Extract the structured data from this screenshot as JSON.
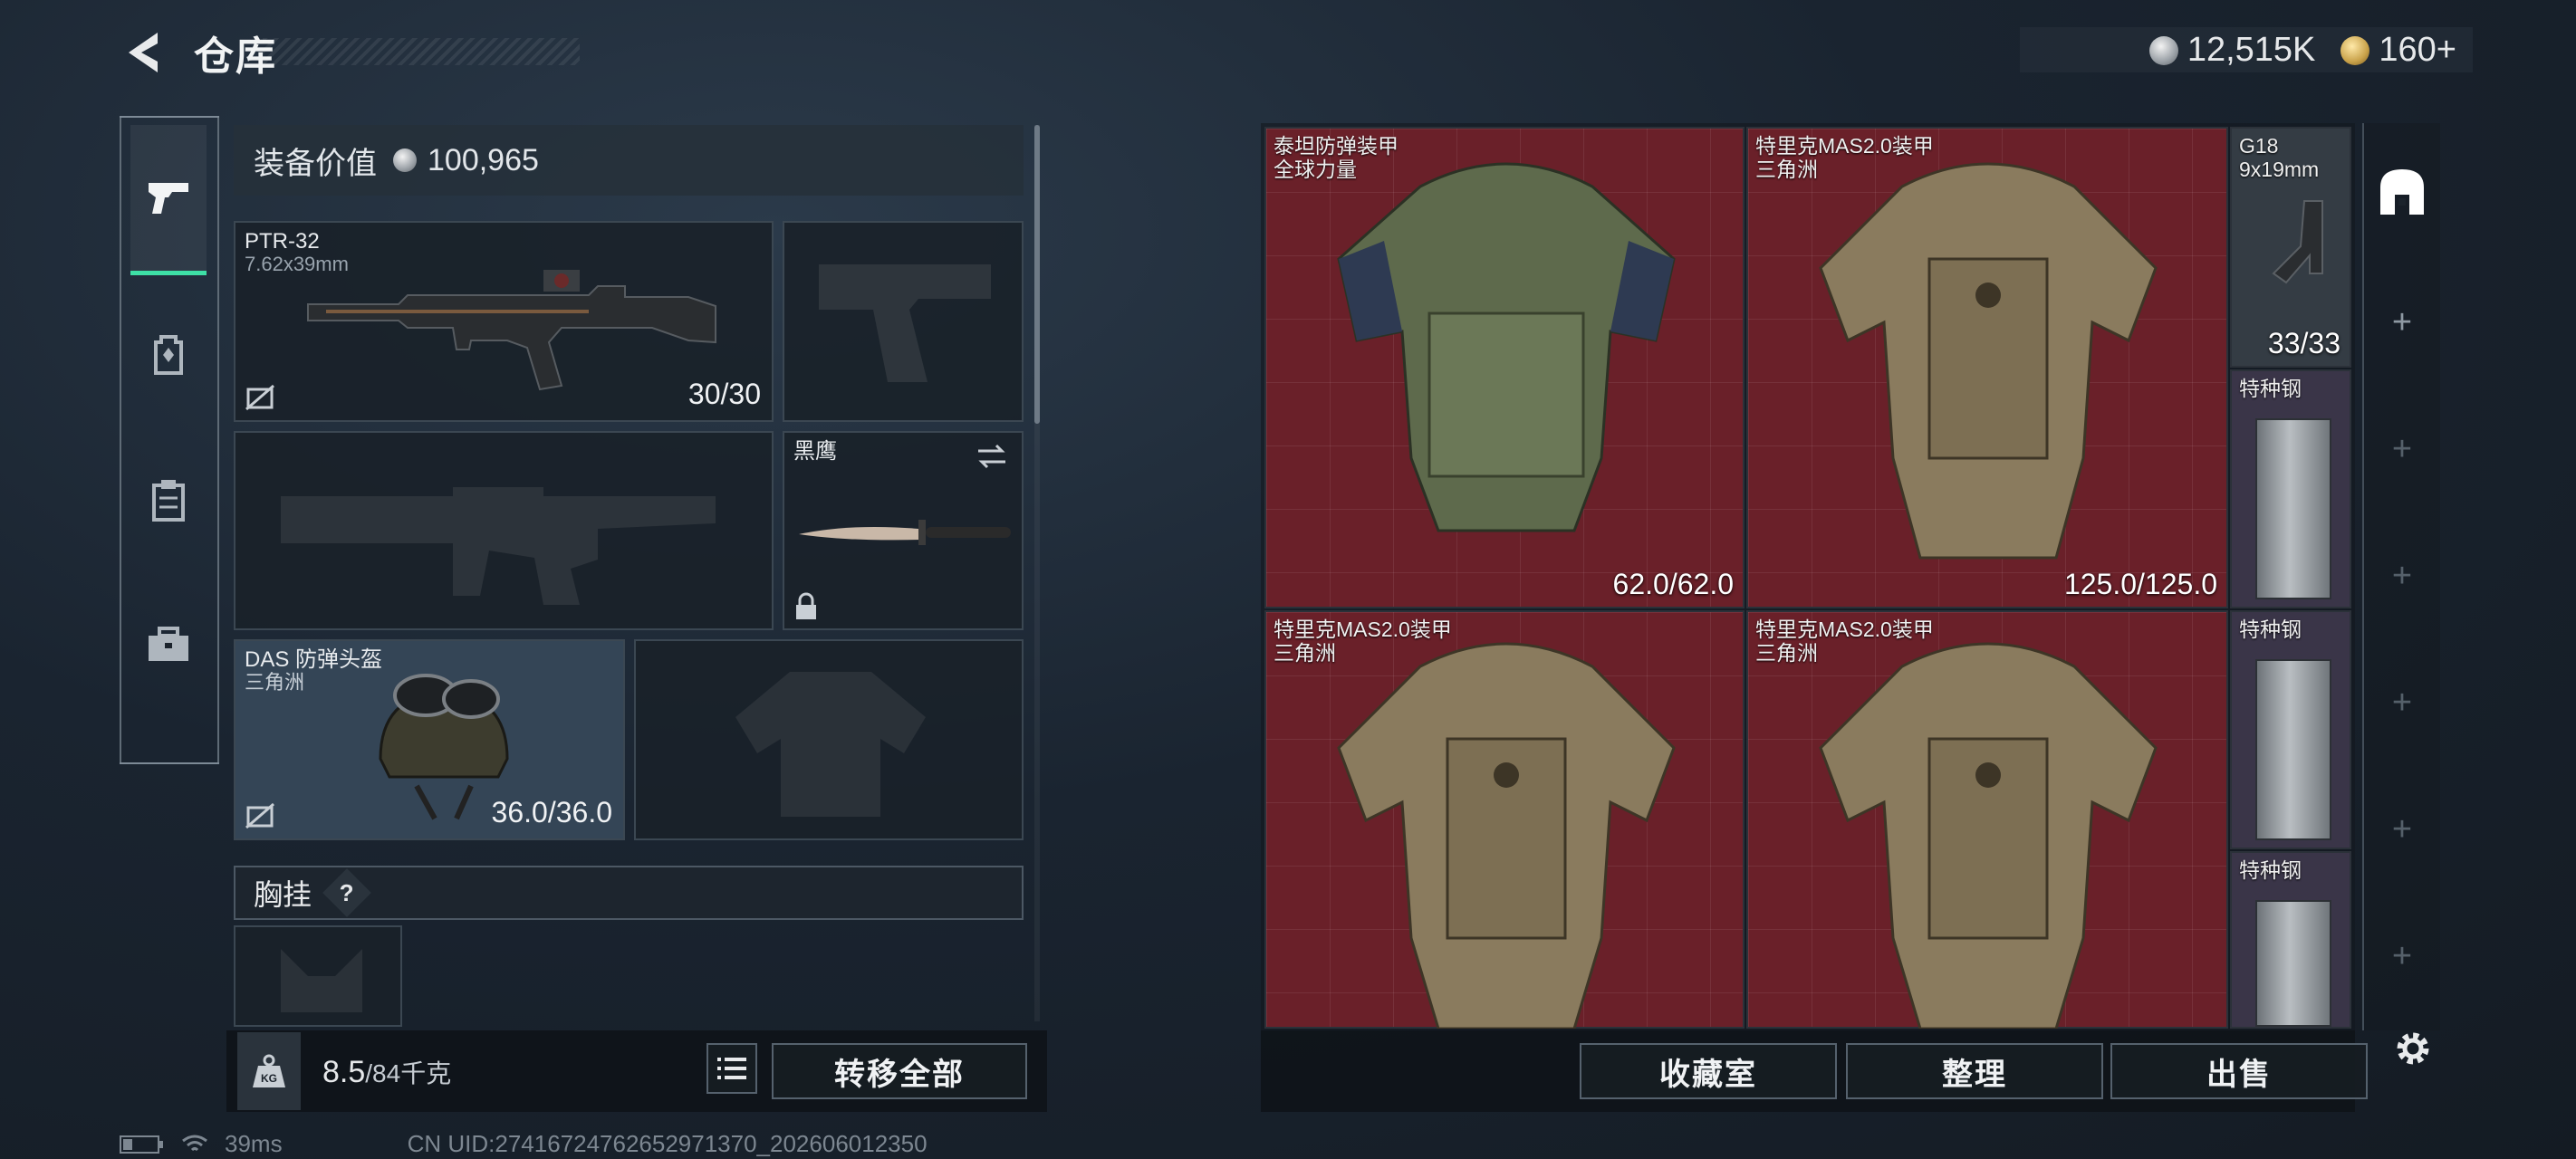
{
  "header": {
    "title": "仓库"
  },
  "currency": {
    "silver": "12,515K",
    "gold": "160+"
  },
  "rail": [
    {
      "name": "weapon",
      "icon": "pistol-icon",
      "active": true
    },
    {
      "name": "gear",
      "icon": "backpack-icon",
      "active": false
    },
    {
      "name": "clipboard",
      "icon": "clipboard-icon",
      "active": false
    },
    {
      "name": "toolbox",
      "icon": "toolbox-icon",
      "active": false
    }
  ],
  "equipment": {
    "value_label": "装备价值",
    "value": "100,965",
    "primary": {
      "name": "PTR-32",
      "caliber": "7.62x39mm",
      "ammo": "30/30"
    },
    "melee": {
      "name": "黑鹰"
    },
    "helmet": {
      "name": "DAS 防弹头盔",
      "brand": "三角洲",
      "durability": "36.0/36.0"
    },
    "chest_label": "胸挂",
    "help": "?",
    "weight": {
      "current": "8.5",
      "max": "/84千克"
    },
    "transfer_all": "转移全部"
  },
  "storage": {
    "items": [
      {
        "name": "泰坦防弹装甲",
        "brand": "全球力量",
        "durability": "62.0/62.0"
      },
      {
        "name": "特里克MAS2.0装甲",
        "brand": "三角洲",
        "durability": "125.0/125.0"
      },
      {
        "name": "G18",
        "brand": "9x19mm",
        "durability": "33/33"
      },
      {
        "name": "特种钢",
        "brand": "",
        "durability": ""
      },
      {
        "name": "特里克MAS2.0装甲",
        "brand": "三角洲",
        "durability": ""
      },
      {
        "name": "特里克MAS2.0装甲",
        "brand": "三角洲",
        "durability": ""
      },
      {
        "name": "特种钢",
        "brand": "",
        "durability": ""
      },
      {
        "name": "特种钢",
        "brand": "",
        "durability": ""
      }
    ],
    "buttons": {
      "collection": "收藏室",
      "sort": "整理",
      "sell": "出售"
    }
  },
  "status": {
    "ping": "39ms",
    "uid": "CN UID:27416724762652971370_202606012350"
  },
  "colors": {
    "accent": "#3ee0a6",
    "cell_red": "#6a2029"
  }
}
